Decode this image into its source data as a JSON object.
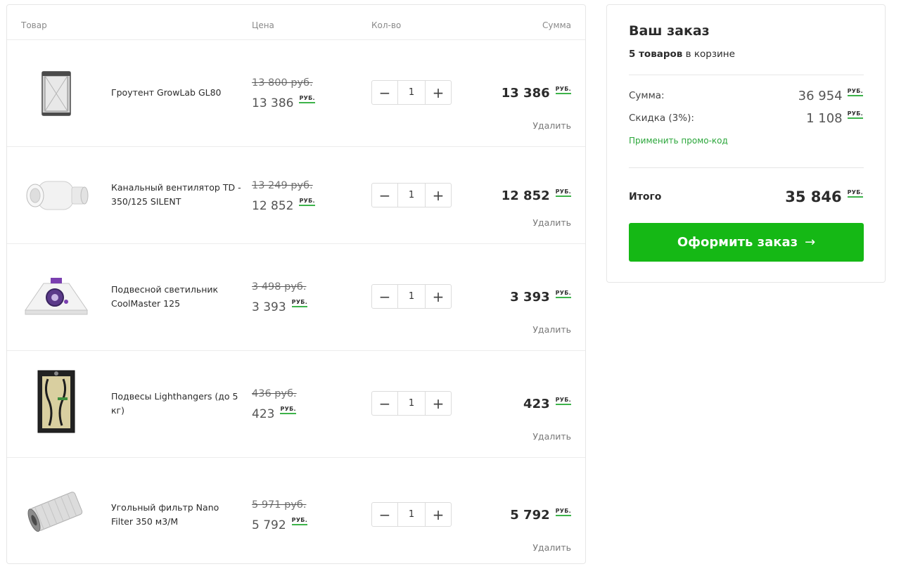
{
  "table": {
    "headers": {
      "product": "Товар",
      "price": "Цена",
      "qty": "Кол-во",
      "sum": "Сумма"
    },
    "currency": "РУБ.",
    "remove_label": "Удалить",
    "items": [
      {
        "name": "Гроутент GrowLab GL80",
        "old_price": "13 800 руб.",
        "price": "13 386",
        "qty": "1",
        "sum": "13 386",
        "image": "grow-tent-image"
      },
      {
        "name": "Канальный вентилятор TD - 350/125 SILENT",
        "old_price": "13 249 руб.",
        "price": "12 852",
        "qty": "1",
        "sum": "12 852",
        "image": "duct-fan-image"
      },
      {
        "name": "Подвесной светильник CoolMaster 125",
        "old_price": "3 498 руб.",
        "price": "3 393",
        "qty": "1",
        "sum": "3 393",
        "image": "reflector-lamp-image"
      },
      {
        "name": "Подвесы Lighthangers (до 5 кг)",
        "old_price": "436 руб.",
        "price": "423",
        "qty": "1",
        "sum": "423",
        "image": "rope-hangers-image"
      },
      {
        "name": "Угольный фильтр Nano Filter 350 м3/М",
        "old_price": "5 971 руб.",
        "price": "5 792",
        "qty": "1",
        "sum": "5 792",
        "image": "carbon-filter-image"
      }
    ]
  },
  "summary": {
    "title": "Ваш заказ",
    "count_bold": "5 товаров",
    "count_rest": " в корзине",
    "sum_label": "Сумма:",
    "sum_value": "36 954",
    "discount_label": "Скидка (3%):",
    "discount_value": "1 108",
    "promo_link": "Применить промо-код",
    "total_label": "Итого",
    "total_value": "35 846",
    "currency": "РУБ.",
    "checkout_label": "Оформить заказ",
    "checkout_arrow": "→"
  },
  "colors": {
    "accent": "#15b815",
    "rub_underline": "#3db34a",
    "link": "#2aa63a"
  }
}
